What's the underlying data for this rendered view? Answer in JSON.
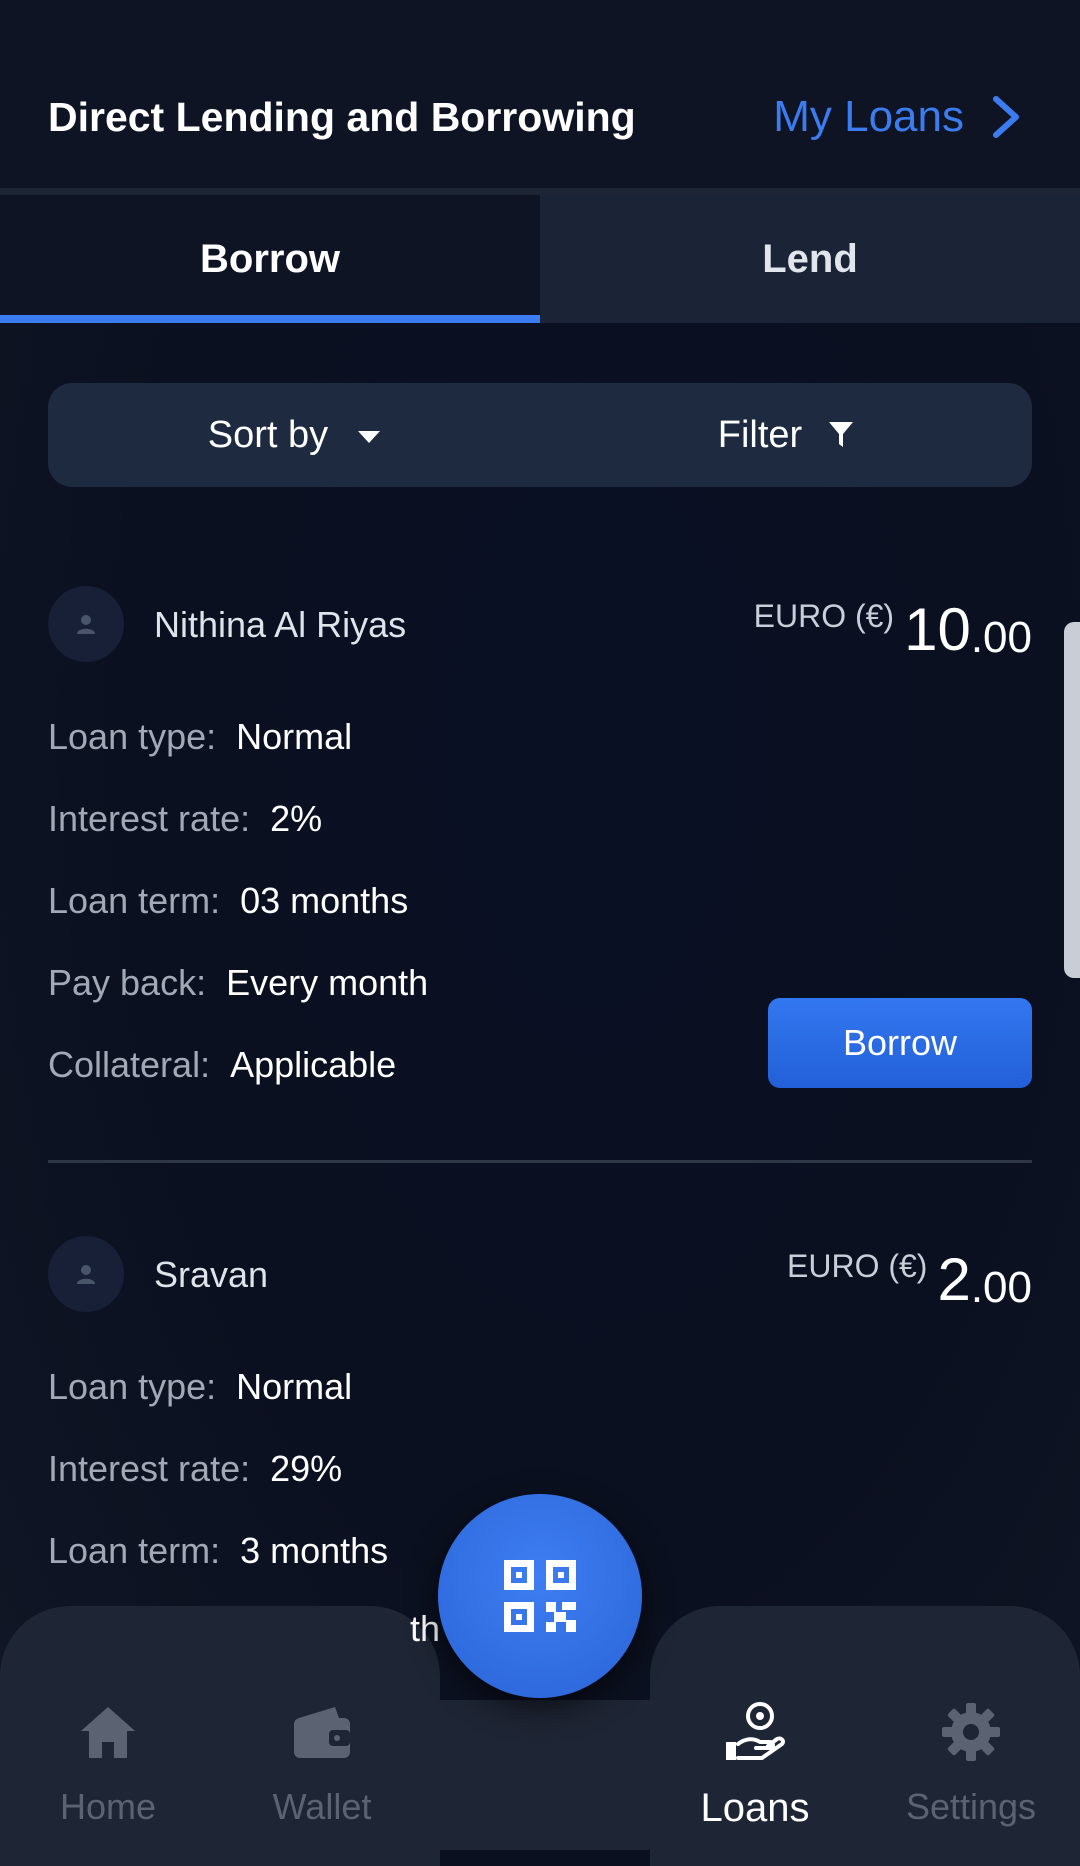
{
  "header": {
    "title": "Direct Lending and Borrowing",
    "my_loans_label": "My Loans"
  },
  "tabs": [
    {
      "label": "Borrow",
      "active": true
    },
    {
      "label": "Lend",
      "active": false
    }
  ],
  "toolbar": {
    "sort_label": "Sort by",
    "filter_label": "Filter"
  },
  "loans": [
    {
      "user": "Nithina Al Riyas",
      "currency": "EURO (€)",
      "amount_int": "10",
      "amount_dec": ".00",
      "fields": [
        {
          "label": "Loan type:",
          "value": "Normal"
        },
        {
          "label": "Interest rate:",
          "value": "2%"
        },
        {
          "label": "Loan term:",
          "value": "03 months"
        },
        {
          "label": "Pay back:",
          "value": "Every month"
        },
        {
          "label": "Collateral:",
          "value": "Applicable"
        }
      ],
      "action_label": "Borrow"
    },
    {
      "user": "Sravan",
      "currency": "EURO (€)",
      "amount_int": "2",
      "amount_dec": ".00",
      "fields": [
        {
          "label": "Loan type:",
          "value": "Normal"
        },
        {
          "label": "Interest rate:",
          "value": "29%"
        },
        {
          "label": "Loan term:",
          "value": "3 months"
        }
      ],
      "peek_text": "th"
    }
  ],
  "bottom_nav": [
    {
      "label": "Home",
      "icon": "home-icon",
      "active": false
    },
    {
      "label": "Wallet",
      "icon": "wallet-icon",
      "active": false
    },
    {
      "label": "Loans",
      "icon": "loans-icon",
      "active": true
    },
    {
      "label": "Settings",
      "icon": "gear-icon",
      "active": false
    }
  ],
  "fab": {
    "icon": "qr-code-icon"
  },
  "colors": {
    "accent": "#3b7cf0",
    "background": "#0b1020",
    "panel": "#1e2a40"
  }
}
